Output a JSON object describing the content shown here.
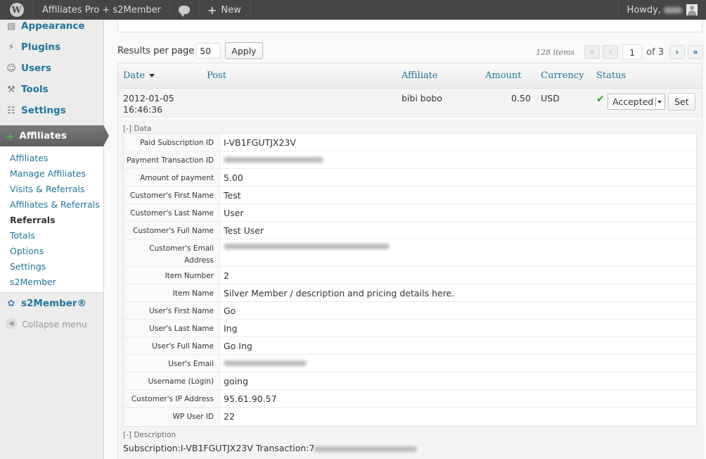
{
  "adminbar": {
    "site_title": "Affiliates Pro + s2Member",
    "new_label": "New",
    "howdy": "Howdy,"
  },
  "sidebar": {
    "top_items": [
      {
        "label": "Appearance",
        "icon": "appearance-icon"
      },
      {
        "label": "Plugins",
        "icon": "plugin-icon"
      },
      {
        "label": "Users",
        "icon": "users-icon"
      },
      {
        "label": "Tools",
        "icon": "tools-icon"
      },
      {
        "label": "Settings",
        "icon": "settings-icon"
      }
    ],
    "current": "Affiliates",
    "submenu": [
      "Affiliates",
      "Manage Affiliates",
      "Visits & Referrals",
      "Affiliates & Referrals",
      "Referrals",
      "Totals",
      "Options",
      "Settings",
      "s2Member"
    ],
    "active_submenu": "Referrals",
    "s2member": "s2Member®",
    "collapse": "Collapse menu"
  },
  "toolbar": {
    "results_per_page_label": "Results per page",
    "results_per_page_value": "50",
    "apply_label": "Apply"
  },
  "pager": {
    "items": "128 items",
    "first": "«",
    "prev": "‹",
    "current_page": "1",
    "of_label": "of 3",
    "next": "›",
    "last": "»"
  },
  "table": {
    "columns": [
      "Date",
      "Post",
      "Affiliate",
      "Amount",
      "Currency",
      "Status"
    ],
    "row": {
      "date": "2012-01-05",
      "time": "16:46:36",
      "affiliate": "bibi bobo",
      "amount": "0.50",
      "currency": "USD",
      "status": "Accepted",
      "set_label": "Set"
    }
  },
  "data_section": {
    "toggle": "[-] Data",
    "fields": [
      {
        "label": "Paid Subscription ID",
        "value": "I-VB1FGUTJX23V"
      },
      {
        "label": "Payment Transaction ID",
        "value": ""
      },
      {
        "label": "Amount of payment",
        "value": "5.00"
      },
      {
        "label": "Customer's First Name",
        "value": "Test"
      },
      {
        "label": "Customer's Last Name",
        "value": "User"
      },
      {
        "label": "Customer's Full Name",
        "value": "Test User"
      },
      {
        "label": "Customer's Email Address",
        "value": ""
      },
      {
        "label": "Item Number",
        "value": "2"
      },
      {
        "label": "Item Name",
        "value": "Silver Member / description and pricing details here."
      },
      {
        "label": "User's First Name",
        "value": "Go"
      },
      {
        "label": "User's Last Name",
        "value": "Ing"
      },
      {
        "label": "User's Full Name",
        "value": "Go Ing"
      },
      {
        "label": "User's Email",
        "value": ""
      },
      {
        "label": "Username (Login)",
        "value": "going"
      },
      {
        "label": "Customer's IP Address",
        "value": "95.61.90.57"
      },
      {
        "label": "WP User ID",
        "value": "22"
      }
    ]
  },
  "description_section": {
    "toggle": "[-] Description",
    "text": "Subscription:I-VB1FGUTJX23V Transaction:7"
  },
  "colors": {
    "link": "#21759b",
    "adminbar": "#464646",
    "accepted_check": "#24a223"
  }
}
